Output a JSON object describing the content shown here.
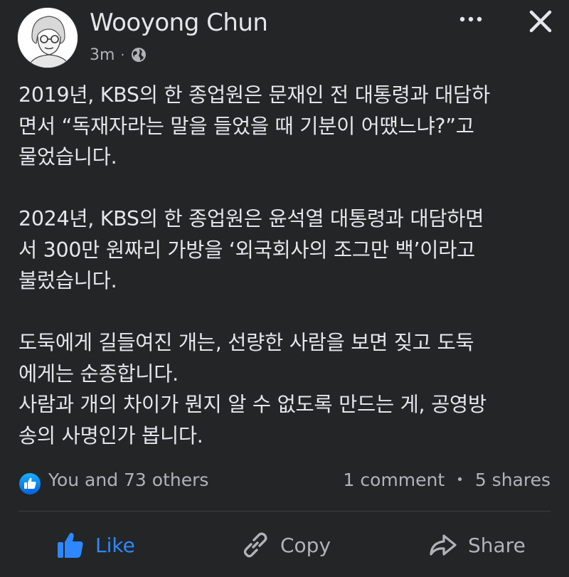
{
  "post": {
    "author": "Wooyong Chun",
    "time": "3m",
    "separator": "·",
    "paragraphs": [
      "2019년, KBS의 한 종업원은 문재인 전 대통령과 대담하\n면서 “독재자라는 말을 들었을 때 기분이 어땠느냐?”고\n물었습니다.",
      "2024년, KBS의 한 종업원은 윤석열 대통령과 대담하면\n서 300만 원짜리 가방을 ‘외국회사의 조그만 백’이라고\n불렀습니다.",
      "도둑에게 길들여진 개는, 선량한 사람을 보면 짖고 도둑\n에게는 순종합니다.\n사람과 개의 차이가 뭔지 알 수 없도록 만드는 게, 공영방\n송의 사명인가 봅니다."
    ]
  },
  "stats": {
    "reactions": "You and 73 others",
    "comments": "1 comment",
    "separator": "•",
    "shares": "5 shares"
  },
  "actions": {
    "like": "Like",
    "copy": "Copy",
    "share": "Share"
  },
  "icons": {
    "more": "more-dots-icon",
    "close": "close-icon",
    "privacy": "globe-icon",
    "like_badge": "thumbs-up-badge-icon",
    "like": "thumbs-up-icon",
    "copy": "link-icon",
    "share": "share-arrow-icon"
  },
  "colors": {
    "background": "#242526",
    "text": "#e4e6eb",
    "secondary": "#b0b3b8",
    "accent": "#2d88ff"
  }
}
